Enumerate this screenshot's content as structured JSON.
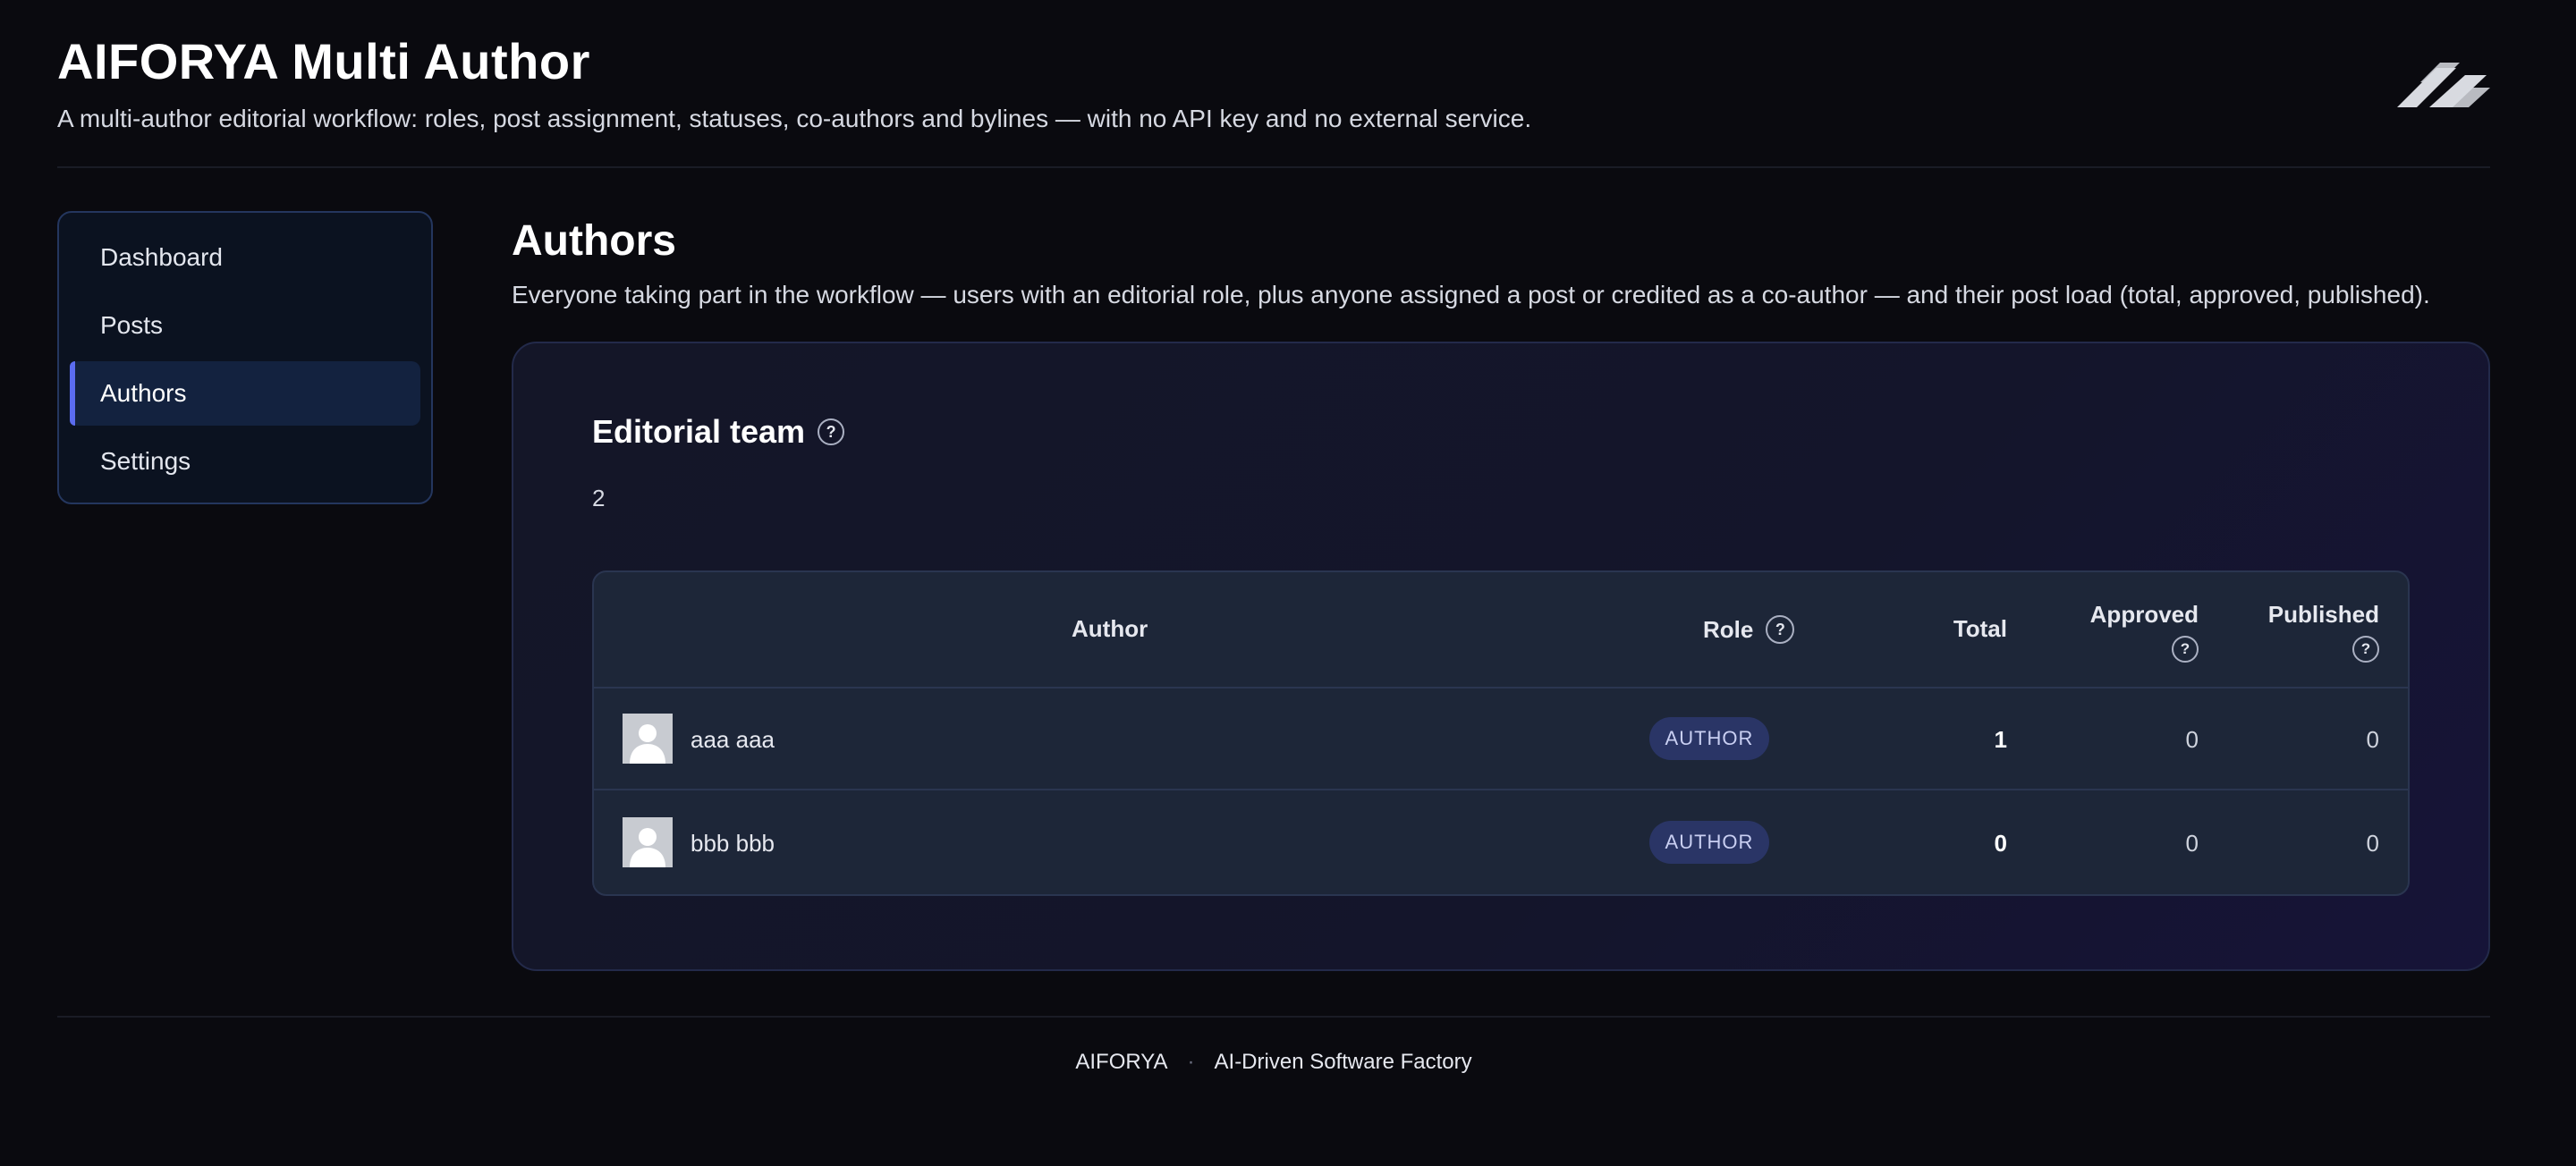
{
  "header": {
    "title": "AIFORYA Multi Author",
    "subtitle": "A multi-author editorial workflow: roles, post assignment, statuses, co-authors and bylines — with no API key and no external service.",
    "logo_icon": "aiforya-logo-icon"
  },
  "sidebar": {
    "items": [
      {
        "label": "Dashboard",
        "active": false
      },
      {
        "label": "Posts",
        "active": false
      },
      {
        "label": "Authors",
        "active": true
      },
      {
        "label": "Settings",
        "active": false
      }
    ]
  },
  "main": {
    "title": "Authors",
    "description": "Everyone taking part in the workflow — users with an editorial role, plus anyone assigned a post or credited as a co-author — and their post load (total, approved, published).",
    "section": {
      "title": "Editorial team",
      "help_icon": "?",
      "count": "2"
    },
    "table": {
      "headers": {
        "author": "Author",
        "role": "Role",
        "total": "Total",
        "approved": "Approved",
        "published": "Published",
        "help": "?"
      },
      "rows": [
        {
          "name": "aaa aaa",
          "role": "AUTHOR",
          "total": "1",
          "approved": "0",
          "published": "0"
        },
        {
          "name": "bbb bbb",
          "role": "AUTHOR",
          "total": "0",
          "approved": "0",
          "published": "0"
        }
      ]
    }
  },
  "footer": {
    "brand": "AIFORYA",
    "separator": "·",
    "tagline": "AI-Driven Software Factory"
  },
  "colors": {
    "background": "#0a0a0f",
    "accent": "#5b6cf0",
    "badge": "#2a3566"
  }
}
